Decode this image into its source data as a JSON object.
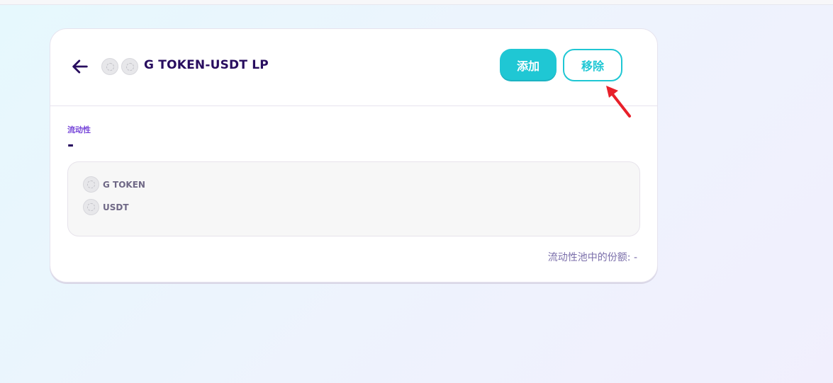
{
  "pair": {
    "title": "G TOKEN-USDT LP",
    "icons": [
      "token-placeholder-icon",
      "token-placeholder-icon"
    ]
  },
  "buttons": {
    "add_label": "添加",
    "remove_label": "移除"
  },
  "liquidity": {
    "label": "流动性",
    "value": "-"
  },
  "tokens": [
    {
      "name": "G TOKEN",
      "icon": "token-placeholder-icon"
    },
    {
      "name": "USDT",
      "icon": "token-placeholder-icon"
    }
  ],
  "pool_share": {
    "text": "流动性池中的份额: -"
  },
  "colors": {
    "accent": "#1fc7d4",
    "title": "#280d5f",
    "secondary": "#7645d9",
    "annotation_arrow": "#e8202a"
  }
}
